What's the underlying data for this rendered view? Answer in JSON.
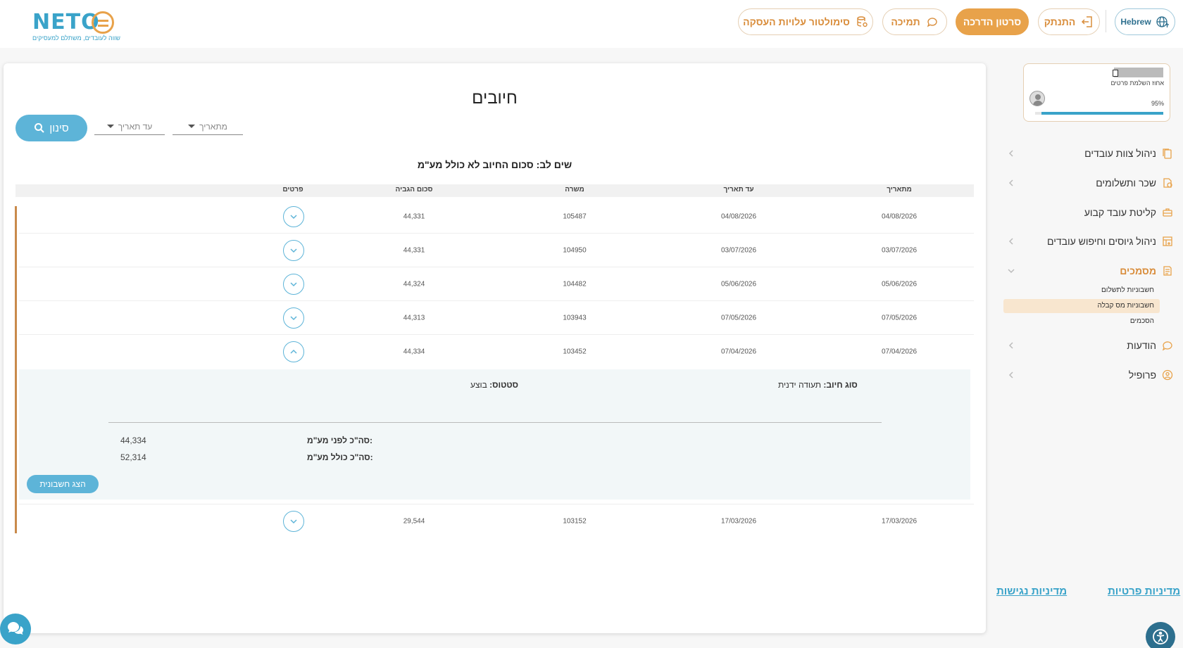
{
  "header": {
    "logo_text": "NETO",
    "logo_tagline": "שווה לעובדים, משתלם למעסיקים",
    "simulator_label": "סימולטור עלויות העסקה",
    "support_label": "תמיכה",
    "tutorial_label": "סרטון הדרכה",
    "logout_label": "התנתק",
    "language_label": "Hebrew"
  },
  "page": {
    "title": "חיובים",
    "filter_label": "סינון",
    "from_date_placeholder": "מתאריך",
    "to_date_placeholder": "עד תאריך",
    "notice": "שים לב: סכום החיוב לא כולל מע\"מ"
  },
  "table": {
    "headers": {
      "from_date": "מתאריך",
      "to_date": "עד תאריך",
      "job": "משרה",
      "amount": "סכום הגביה",
      "details": "פרטים"
    },
    "rows": [
      {
        "from_date": "04/08/2026",
        "to_date": "04/08/2026",
        "job": "105487",
        "amount": "44,331",
        "expanded": false
      },
      {
        "from_date": "03/07/2026",
        "to_date": "03/07/2026",
        "job": "104950",
        "amount": "44,331",
        "expanded": false
      },
      {
        "from_date": "05/06/2026",
        "to_date": "05/06/2026",
        "job": "104482",
        "amount": "44,324",
        "expanded": false
      },
      {
        "from_date": "07/05/2026",
        "to_date": "07/05/2026",
        "job": "103943",
        "amount": "44,313",
        "expanded": false
      },
      {
        "from_date": "07/04/2026",
        "to_date": "07/04/2026",
        "job": "103452",
        "amount": "44,334",
        "expanded": true
      },
      {
        "from_date": "17/03/2026",
        "to_date": "17/03/2026",
        "job": "103152",
        "amount": "29,544",
        "expanded": false
      }
    ],
    "detail": {
      "charge_type_label": "סוג חיוב:",
      "charge_type_value": "תעודה ידנית",
      "status_label": "סטטוס:",
      "status_value": "בוצע",
      "total_before_vat_label": "סה\"כ לפני מע\"מ:",
      "total_before_vat_value": "44,334",
      "total_with_vat_label": "סה\"כ כולל מע\"מ:",
      "total_with_vat_value": "52,314",
      "show_invoice_label": "הצג חשבונית"
    }
  },
  "sidebar": {
    "profile": {
      "completion_label": "אחוז השלמת פרטים",
      "completion_pct_text": "95%",
      "completion_value": 0.95
    },
    "items": [
      {
        "label": "ניהול צוות עובדים",
        "icon": "files-icon",
        "has_chevron": true
      },
      {
        "label": "שכר ותשלומים",
        "icon": "payroll-icon",
        "has_chevron": true
      },
      {
        "label": "קליטת עובד קבוע",
        "icon": "briefcase-icon",
        "has_chevron": false
      },
      {
        "label": "ניהול גיוסים וחיפוש עובדים",
        "icon": "grid-plus-icon",
        "has_chevron": true
      },
      {
        "label": "מסמכים",
        "icon": "documents-icon",
        "has_chevron": true,
        "active": true
      },
      {
        "label": "הודעות",
        "icon": "message-icon",
        "has_chevron": true
      },
      {
        "label": "פרופיל",
        "icon": "user-circle-icon",
        "has_chevron": true
      }
    ],
    "sub_items": [
      {
        "label": "חשבוניות לתשלום"
      },
      {
        "label": "חשבוניות מס קבלה",
        "active": true
      },
      {
        "label": "הסכמים"
      }
    ]
  },
  "footer": {
    "privacy_label": "מדיניות פרטיות",
    "accessibility_label": "מדיניות נגישות"
  },
  "colors": {
    "accent": "#e8a24a",
    "primary": "#5db4d8",
    "brand_blue": "#3aa3c9"
  }
}
